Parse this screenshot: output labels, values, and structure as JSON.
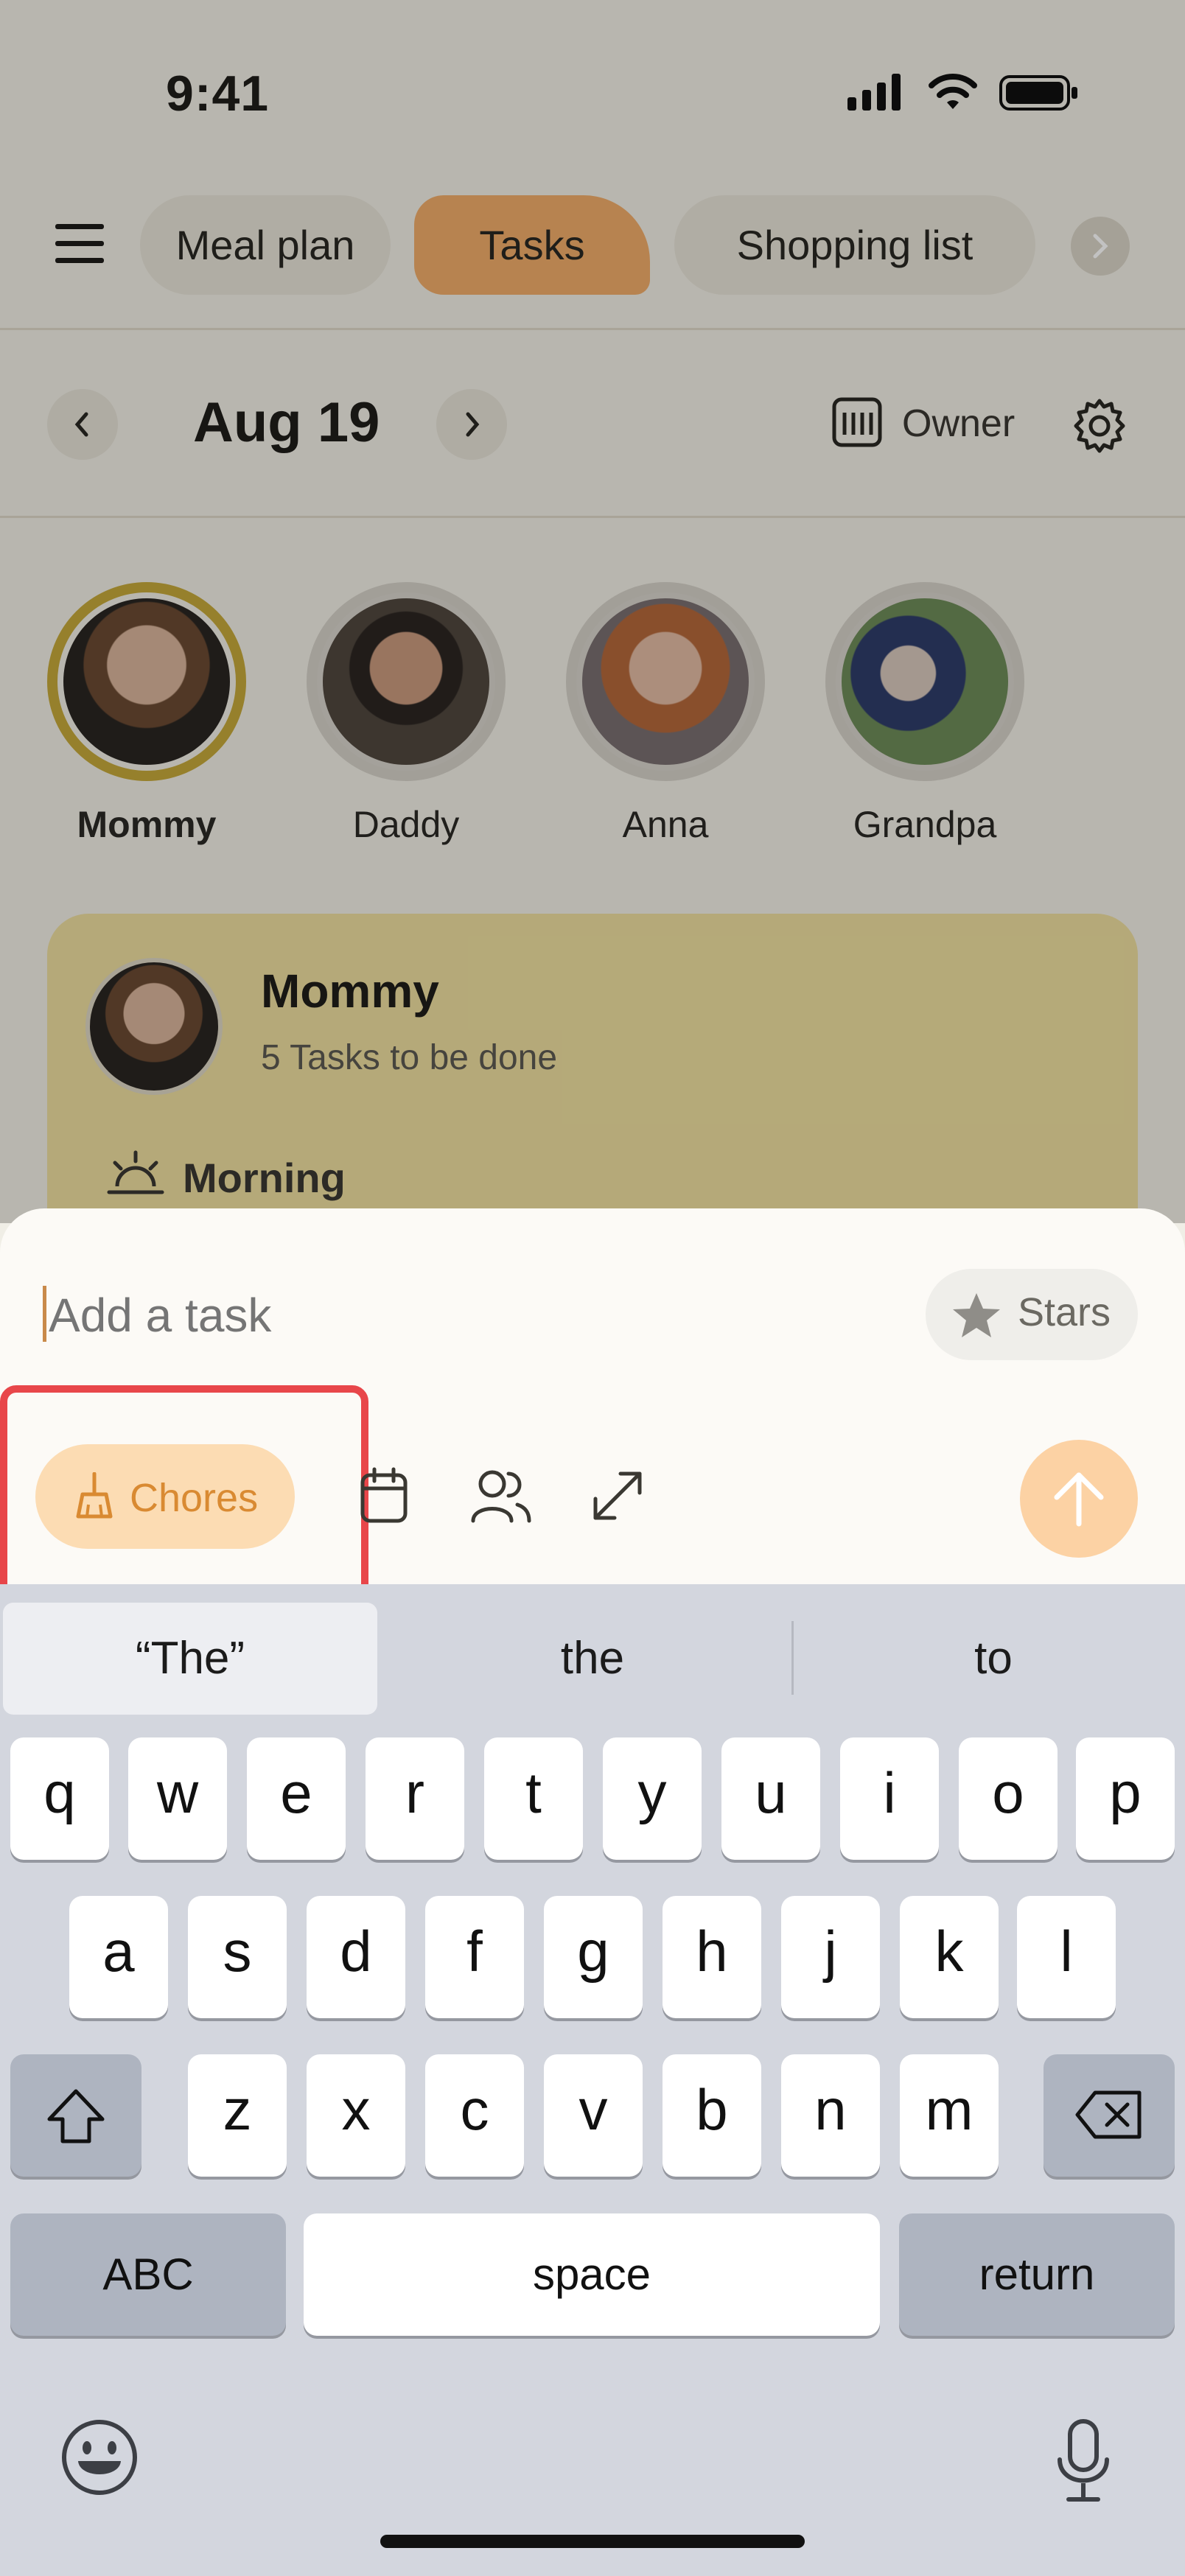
{
  "status": {
    "time": "9:41"
  },
  "tabs": [
    {
      "label": "Meal plan"
    },
    {
      "label": "Tasks"
    },
    {
      "label": "Shopping list"
    }
  ],
  "header": {
    "date": "Aug 19",
    "owner_label": "Owner"
  },
  "people": [
    {
      "name": "Mommy"
    },
    {
      "name": "Daddy"
    },
    {
      "name": "Anna"
    },
    {
      "name": "Grandpa"
    }
  ],
  "card": {
    "name": "Mommy",
    "subtitle": "5 Tasks to be done",
    "section": "Morning"
  },
  "task_input": {
    "placeholder": "Add a task",
    "stars_label": "Stars",
    "chip_label": "Chores"
  },
  "keyboard": {
    "suggestions": [
      "“The”",
      "the",
      "to"
    ],
    "row1": [
      "q",
      "w",
      "e",
      "r",
      "t",
      "y",
      "u",
      "i",
      "o",
      "p"
    ],
    "row2": [
      "a",
      "s",
      "d",
      "f",
      "g",
      "h",
      "j",
      "k",
      "l"
    ],
    "row3": [
      "z",
      "x",
      "c",
      "v",
      "b",
      "n",
      "m"
    ],
    "abc_label": "ABC",
    "space_label": "space",
    "return_label": "return"
  },
  "colors": {
    "accent": "#f1ad6a",
    "highlight_frame": "#e8464a",
    "selected_ring": "#c6a93a"
  }
}
